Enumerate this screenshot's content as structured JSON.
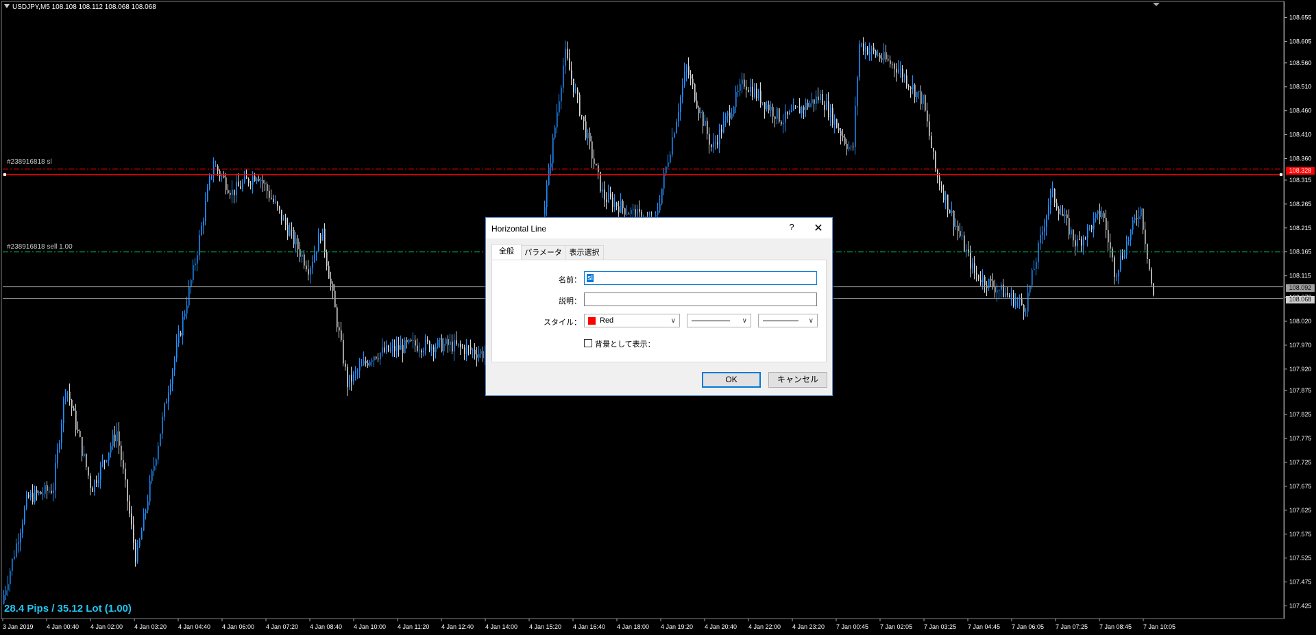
{
  "window": {
    "symbol_header": "USDJPY,M5  108.108 108.112 108.068 108.068"
  },
  "orders": {
    "sl_label": "#238916818 sl",
    "entry_label": "#238916818 sell 1.00"
  },
  "overlay": {
    "pips_text": "28.4 Pips / 35.12 Lot (1.00)"
  },
  "colors": {
    "background": "#000000",
    "bull": "#1e90ff",
    "bear": "#d8d8d8",
    "sl_line": "#ff0000",
    "entry_line": "#00b050",
    "price_line": "#9a9a9a",
    "pips_text": "#21c6f2"
  },
  "price_axis": {
    "ticks": [
      "108.655",
      "108.605",
      "108.560",
      "108.510",
      "108.460",
      "108.410",
      "108.360",
      "108.315",
      "108.265",
      "108.215",
      "108.165",
      "108.115",
      "108.070",
      "108.020",
      "107.970",
      "107.920",
      "107.875",
      "107.825",
      "107.775",
      "107.725",
      "107.675",
      "107.625",
      "107.575",
      "107.525",
      "107.475",
      "107.425"
    ],
    "tag_sl": "108.328",
    "tag_bid": "108.092",
    "tag_last": "108.068"
  },
  "time_axis": {
    "ticks": [
      "3 Jan 2019",
      "4 Jan 00:40",
      "4 Jan 02:00",
      "4 Jan 03:20",
      "4 Jan 04:40",
      "4 Jan 06:00",
      "4 Jan 07:20",
      "4 Jan 08:40",
      "4 Jan 10:00",
      "4 Jan 11:20",
      "4 Jan 12:40",
      "4 Jan 14:00",
      "4 Jan 15:20",
      "4 Jan 16:40",
      "4 Jan 18:00",
      "4 Jan 19:20",
      "4 Jan 20:40",
      "4 Jan 22:00",
      "4 Jan 23:20",
      "7 Jan 00:45",
      "7 Jan 02:05",
      "7 Jan 03:25",
      "7 Jan 04:45",
      "7 Jan 06:05",
      "7 Jan 07:25",
      "7 Jan 08:45",
      "7 Jan 10:05"
    ]
  },
  "chart_data": {
    "type": "candlestick",
    "symbol": "USDJPY",
    "timeframe": "M5",
    "ylim": [
      107.4,
      108.68
    ],
    "levels": {
      "stop_loss": 108.328,
      "entry": 108.165,
      "bid": 108.092,
      "last": 108.068
    },
    "close_path": [
      {
        "t": 0,
        "v": 107.43
      },
      {
        "t": 0.02,
        "v": 107.65
      },
      {
        "t": 0.04,
        "v": 107.67
      },
      {
        "t": 0.05,
        "v": 107.89
      },
      {
        "t": 0.07,
        "v": 107.67
      },
      {
        "t": 0.09,
        "v": 107.79
      },
      {
        "t": 0.105,
        "v": 107.52
      },
      {
        "t": 0.13,
        "v": 107.88
      },
      {
        "t": 0.15,
        "v": 108.13
      },
      {
        "t": 0.165,
        "v": 108.35
      },
      {
        "t": 0.18,
        "v": 108.29
      },
      {
        "t": 0.2,
        "v": 108.33
      },
      {
        "t": 0.24,
        "v": 108.13
      },
      {
        "t": 0.25,
        "v": 108.21
      },
      {
        "t": 0.27,
        "v": 107.89
      },
      {
        "t": 0.29,
        "v": 107.95
      },
      {
        "t": 0.32,
        "v": 107.97
      },
      {
        "t": 0.35,
        "v": 107.97
      },
      {
        "t": 0.38,
        "v": 107.95
      },
      {
        "t": 0.42,
        "v": 108.18
      },
      {
        "t": 0.44,
        "v": 108.58
      },
      {
        "t": 0.47,
        "v": 108.28
      },
      {
        "t": 0.51,
        "v": 108.22
      },
      {
        "t": 0.535,
        "v": 108.55
      },
      {
        "t": 0.555,
        "v": 108.38
      },
      {
        "t": 0.58,
        "v": 108.52
      },
      {
        "t": 0.61,
        "v": 108.44
      },
      {
        "t": 0.64,
        "v": 108.49
      },
      {
        "t": 0.665,
        "v": 108.37
      },
      {
        "t": 0.67,
        "v": 108.6
      },
      {
        "t": 0.7,
        "v": 108.55
      },
      {
        "t": 0.72,
        "v": 108.48
      },
      {
        "t": 0.73,
        "v": 108.33
      },
      {
        "t": 0.76,
        "v": 108.12
      },
      {
        "t": 0.8,
        "v": 108.05
      },
      {
        "t": 0.82,
        "v": 108.29
      },
      {
        "t": 0.84,
        "v": 108.18
      },
      {
        "t": 0.86,
        "v": 108.25
      },
      {
        "t": 0.87,
        "v": 108.12
      },
      {
        "t": 0.89,
        "v": 108.26
      },
      {
        "t": 0.9,
        "v": 108.068
      }
    ]
  },
  "dialog": {
    "title": "Horizontal Line",
    "help_glyph": "?",
    "close_glyph": "✕",
    "tabs": [
      "全般",
      "パラメーター",
      "表示選択"
    ],
    "name_label": "名前：",
    "name_value": "sl",
    "desc_label": "説明：",
    "desc_value": "",
    "style_label": "スタイル：",
    "color_value": "Red",
    "color_swatch": "#ff0000",
    "background_label": "背景として表示：",
    "ok_label": "OK",
    "cancel_label": "キャンセル"
  }
}
